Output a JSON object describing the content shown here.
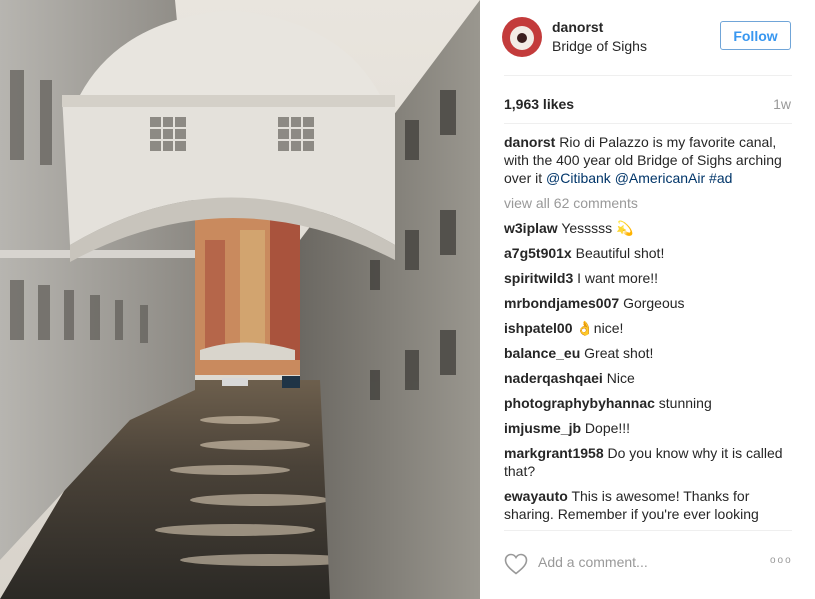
{
  "post": {
    "username": "danorst",
    "location": "Bridge of Sighs",
    "follow_label": "Follow",
    "likes": "1,963 likes",
    "time": "1w",
    "caption": {
      "user": "danorst",
      "text": "Rio di Palazzo is my favorite canal, with the 400 year old Bridge of Sighs arching over it",
      "mention1": "@Citibank",
      "mention2": "@AmericanAir",
      "hashtag": "#ad"
    },
    "view_all": "view all 62 comments",
    "comments": [
      {
        "user": "w3iplaw",
        "text": "Yesssss 💫"
      },
      {
        "user": "a7g5t901x",
        "text": "Beautiful shot!"
      },
      {
        "user": "spiritwild3",
        "text": "I want more!!"
      },
      {
        "user": "mrbondjames007",
        "text": "Gorgeous"
      },
      {
        "user": "ishpatel00",
        "text": "👌nice!"
      },
      {
        "user": "balance_eu",
        "text": "Great shot!"
      },
      {
        "user": "naderqashqaei",
        "text": "Nice"
      },
      {
        "user": "photographybyhannac",
        "text": "stunning"
      },
      {
        "user": "imjusme_jb",
        "text": "Dope!!!"
      },
      {
        "user": "markgrant1958",
        "text": "Do you know why it is called that?"
      },
      {
        "user": "ewayauto",
        "text": "This is awesome! Thanks for sharing. Remember if you're ever looking"
      }
    ],
    "add_comment_placeholder": "Add a comment...",
    "more_symbol": "ooo",
    "icons": {
      "like": "heart-icon",
      "more": "more-options-icon"
    }
  }
}
